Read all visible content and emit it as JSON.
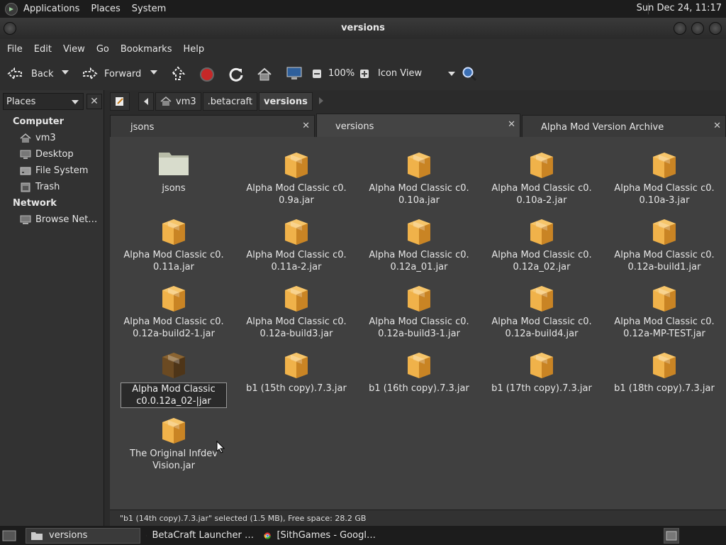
{
  "top_panel": {
    "menus": [
      "Applications",
      "Places",
      "System"
    ],
    "clock": "Sun Dec 24, 11:17"
  },
  "window": {
    "title": "versions"
  },
  "menubar": [
    "File",
    "Edit",
    "View",
    "Go",
    "Bookmarks",
    "Help"
  ],
  "toolbar": {
    "back": "Back",
    "forward": "Forward",
    "zoom": "100%",
    "view_mode": "Icon View"
  },
  "sidebar": {
    "selector": "Places",
    "sections": [
      {
        "heading": "Computer",
        "items": [
          {
            "label": "vm3",
            "icon": "home-icon"
          },
          {
            "label": "Desktop",
            "icon": "desktop-icon"
          },
          {
            "label": "File System",
            "icon": "drive-icon"
          },
          {
            "label": "Trash",
            "icon": "trash-icon"
          }
        ]
      },
      {
        "heading": "Network",
        "items": [
          {
            "label": "Browse Net…",
            "icon": "network-icon"
          }
        ]
      }
    ]
  },
  "pathbar": {
    "crumbs": [
      "vm3",
      ".betacraft",
      "versions"
    ],
    "active": "versions"
  },
  "tabs": [
    {
      "label": "jsons",
      "active": false
    },
    {
      "label": "versions",
      "active": true
    },
    {
      "label": "Alpha Mod Version Archive",
      "active": false
    }
  ],
  "files": [
    {
      "line1": "jsons",
      "line2": "",
      "type": "folder"
    },
    {
      "line1": "Alpha Mod Classic c0.",
      "line2": "0.9a.jar",
      "type": "jar"
    },
    {
      "line1": "Alpha Mod Classic c0.",
      "line2": "0.10a.jar",
      "type": "jar"
    },
    {
      "line1": "Alpha Mod Classic c0.",
      "line2": "0.10a-2.jar",
      "type": "jar"
    },
    {
      "line1": "Alpha Mod Classic c0.",
      "line2": "0.10a-3.jar",
      "type": "jar"
    },
    {
      "line1": "Alpha Mod Classic c0.",
      "line2": "0.11a.jar",
      "type": "jar"
    },
    {
      "line1": "Alpha Mod Classic c0.",
      "line2": "0.11a-2.jar",
      "type": "jar"
    },
    {
      "line1": "Alpha Mod Classic c0.",
      "line2": "0.12a_01.jar",
      "type": "jar"
    },
    {
      "line1": "Alpha Mod Classic c0.",
      "line2": "0.12a_02.jar",
      "type": "jar"
    },
    {
      "line1": "Alpha Mod Classic c0.",
      "line2": "0.12a-build1.jar",
      "type": "jar"
    },
    {
      "line1": "Alpha Mod Classic c0.",
      "line2": "0.12a-build2-1.jar",
      "type": "jar"
    },
    {
      "line1": "Alpha Mod Classic c0.",
      "line2": "0.12a-build3.jar",
      "type": "jar"
    },
    {
      "line1": "Alpha Mod Classic c0.",
      "line2": "0.12a-build3-1.jar",
      "type": "jar"
    },
    {
      "line1": "Alpha Mod Classic c0.",
      "line2": "0.12a-build4.jar",
      "type": "jar"
    },
    {
      "line1": "Alpha Mod Classic c0.",
      "line2": "0.12a-MP-TEST.jar",
      "type": "jar"
    },
    {
      "line1": "Alpha Mod Classic",
      "line2": "c0.0.12a_02-|jar",
      "type": "jar-selected",
      "renaming": true
    },
    {
      "line1": "b1 (15th copy).7.3.jar",
      "line2": "",
      "type": "jar"
    },
    {
      "line1": "b1 (16th copy).7.3.jar",
      "line2": "",
      "type": "jar"
    },
    {
      "line1": "b1 (17th copy).7.3.jar",
      "line2": "",
      "type": "jar"
    },
    {
      "line1": "b1 (18th copy).7.3.jar",
      "line2": "",
      "type": "jar"
    },
    {
      "line1": "The Original Infdev",
      "line2": "Vision.jar",
      "type": "jar"
    }
  ],
  "statusbar": "\"b1 (14th copy).7.3.jar\" selected (1.5 MB), Free space: 28.2 GB",
  "taskbar": [
    {
      "label": "versions",
      "active": true,
      "icon": "folder-icon"
    },
    {
      "label": "BetaCraft Launcher …",
      "active": false,
      "icon": "app-icon"
    },
    {
      "label": "[SithGames - Googl…",
      "active": false,
      "icon": "chrome-icon"
    }
  ],
  "colors": {
    "jar": "#f0b24a",
    "jar_dark": "#c98424",
    "jar_selected": "#6b4a22",
    "folder": "#d8dccc"
  }
}
